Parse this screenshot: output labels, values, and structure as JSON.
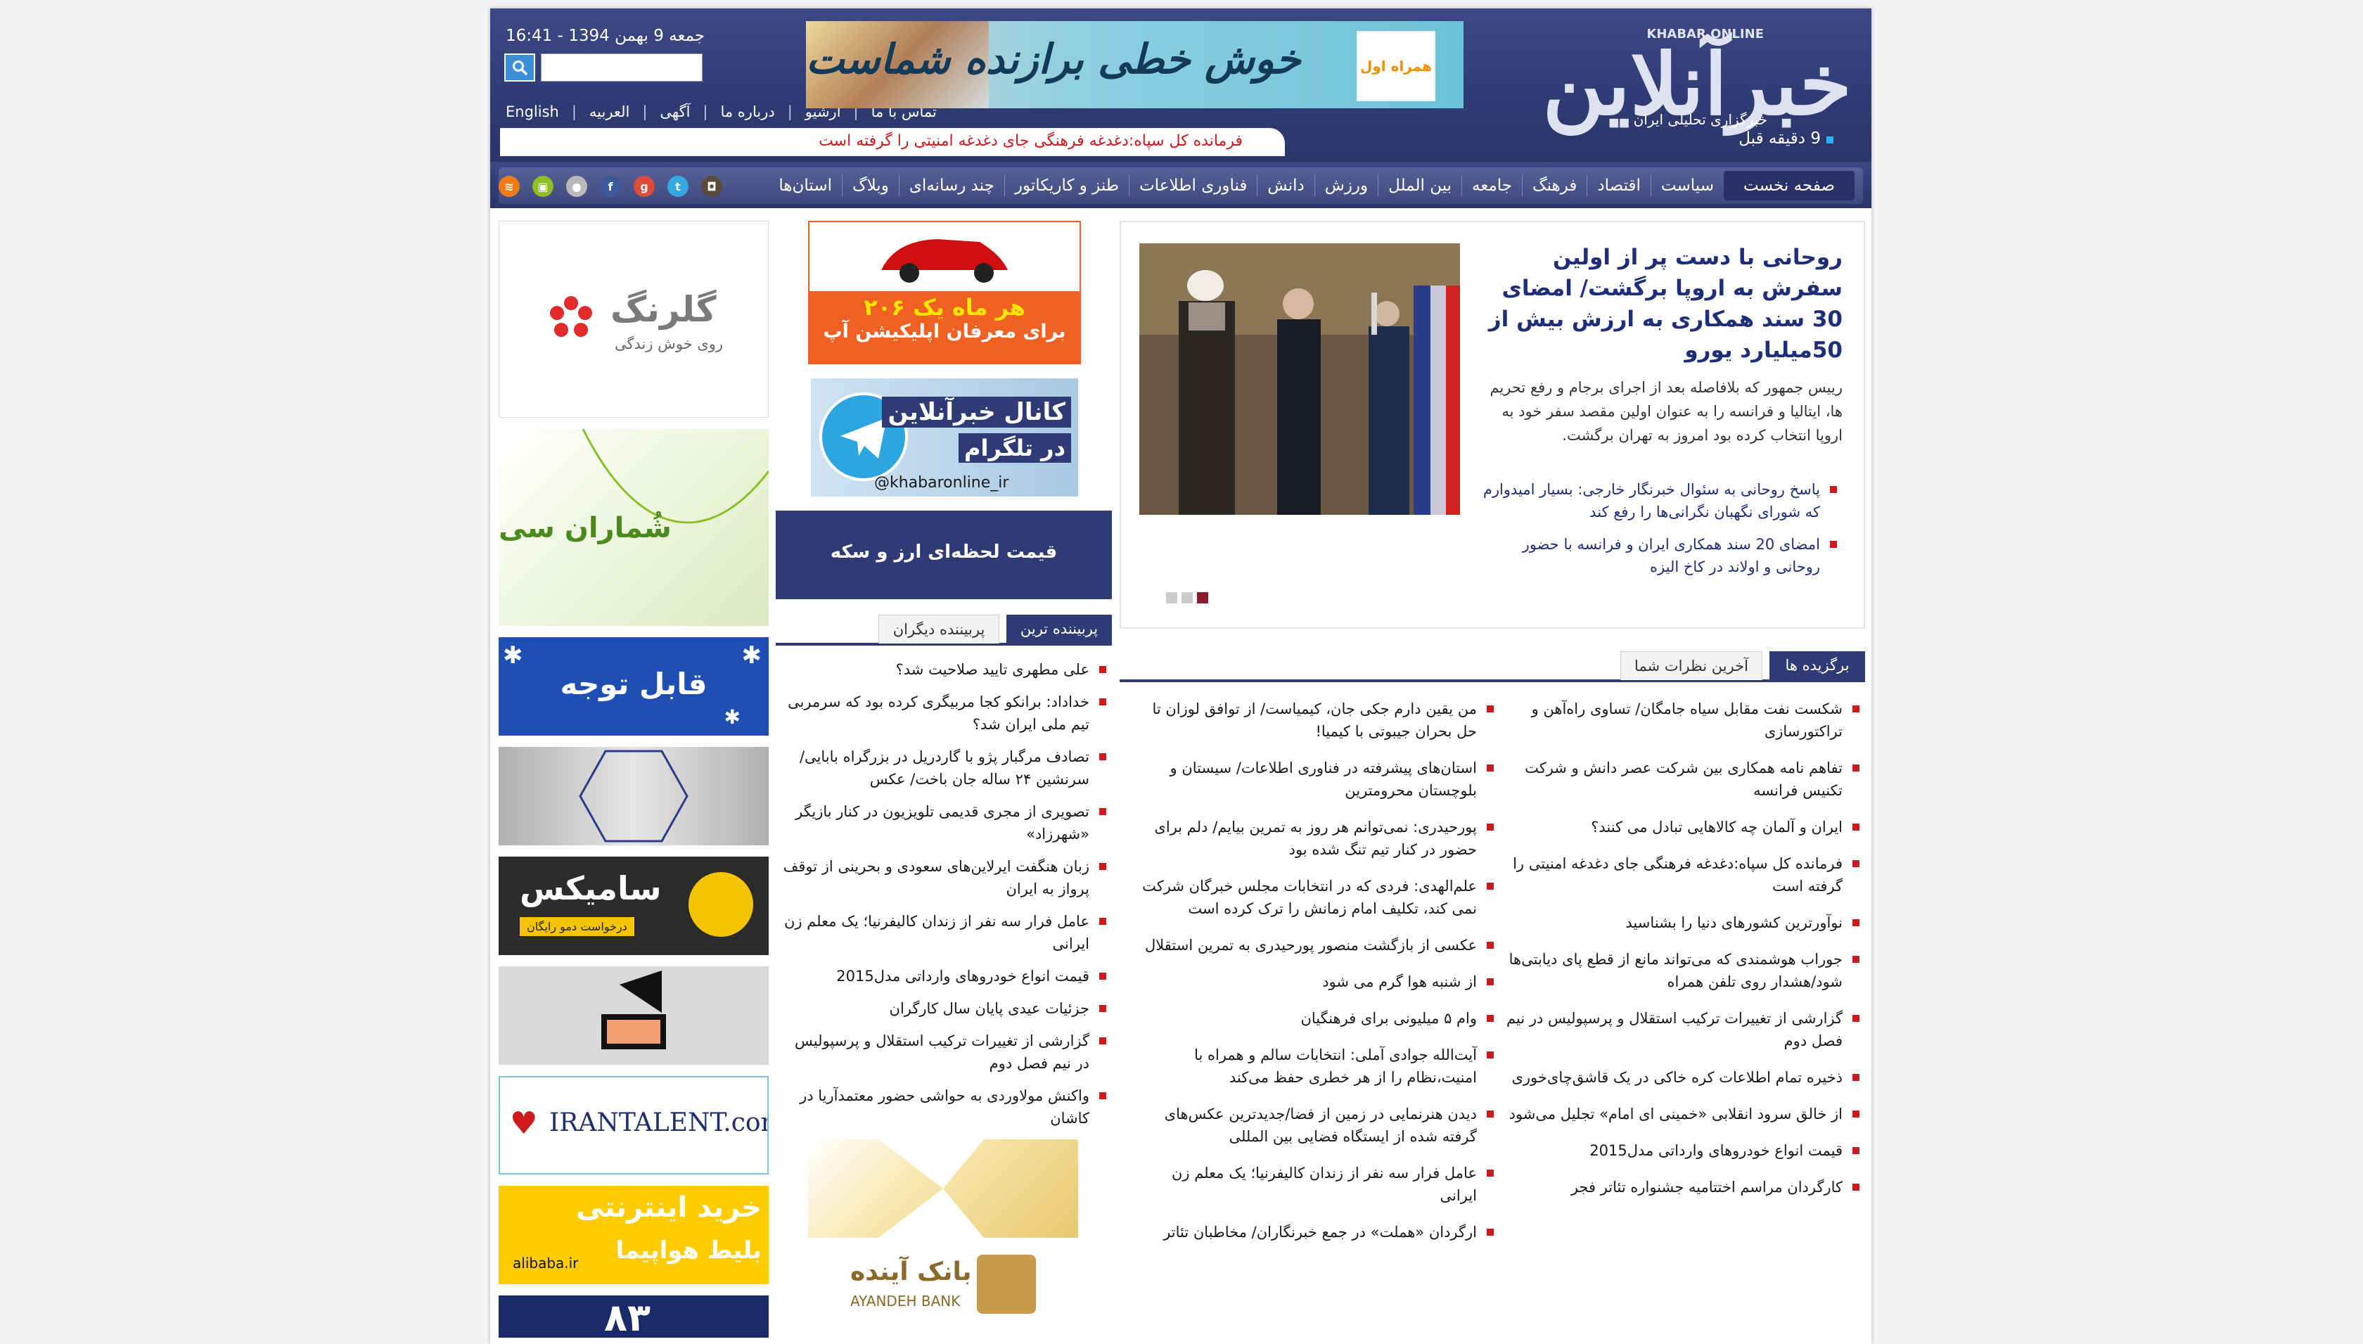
{
  "header": {
    "datetime": "جمعه 9 بهمن 1394 - 16:41",
    "logo_brand": "خبرآنلاین",
    "logo_en": "KHABAR ONLINE",
    "tagline": "خبرگزاری تحلیلی ایران",
    "banner_text": "خوش خطی برازنده شماست ...",
    "banner_logo": "همراه اول",
    "toplinks": [
      "تماس با ما",
      "آرشیو",
      "درباره ما",
      "آگهی",
      "العربیه",
      "English"
    ],
    "ticker_time": "9 دقیقه قبل",
    "ticker_text": "فرمانده کل سپاه:دغدغه فرهنگی جای دغدغه امنیتی را گرفته است"
  },
  "nav": {
    "items": [
      "صفحه نخست",
      "سیاست",
      "اقتصاد",
      "فرهنگ",
      "جامعه",
      "بین الملل",
      "ورزش",
      "دانش",
      "فناوری اطلاعات",
      "طنز و کاریکاتور",
      "چند رسانه‌ای",
      "وبلاگ",
      "استان‌ها"
    ],
    "socials": [
      {
        "name": "rss-icon",
        "color": "#f07a18",
        "glyph": "≋"
      },
      {
        "name": "android-icon",
        "color": "#8cbf26",
        "glyph": "▣"
      },
      {
        "name": "apple-icon",
        "color": "#b9b9b9",
        "glyph": "●"
      },
      {
        "name": "facebook-icon",
        "color": "#3b5998",
        "glyph": "f"
      },
      {
        "name": "googleplus-icon",
        "color": "#dd4b39",
        "glyph": "g"
      },
      {
        "name": "twitter-icon",
        "color": "#35a8e0",
        "glyph": "t"
      },
      {
        "name": "instagram-icon",
        "color": "#5b4b3a",
        "glyph": "◘"
      }
    ]
  },
  "ads": {
    "golrang": {
      "title": "گلرنگ",
      "sub": "روی خوش زندگی"
    },
    "shomaran": "شُماران سی",
    "attention": "قابل توجه",
    "samix": {
      "title": "سامیکس",
      "sub": "درخواست دمو رایگان"
    },
    "irantalent": "IRANTALENT.com",
    "alibaba": {
      "title": "خرید اینترنتی",
      "sub": "بلیط هواپیما",
      "brand": "alibaba.ir"
    },
    "bottom": "۸۳",
    "car": {
      "line1": "هر ماه یک ۲۰۶",
      "line2": "برای معرفان اپلیکیشن آپ"
    },
    "telegram": {
      "line1": "کانال خبرآنلاین",
      "line2": "در تلگرام",
      "handle": "@khabaronline_ir"
    },
    "rates": "قیمت لحظه‌ای ارز و سکه",
    "bank": {
      "fa": "بانک آینده",
      "en": "AYANDEH BANK"
    }
  },
  "midtabs": {
    "on": "پربیننده ترین",
    "off": "پربیننده دیگران"
  },
  "mostviewed": [
    "علی مطهری تایید صلاحیت شد؟",
    "خداداد: برانکو کجا مربیگری کرده بود که سرمربی تیم ملی ایران شد؟",
    "تصادف مرگبار پژو با گاردریل در بزرگراه بابایی/ سرنشین ۲۴ ساله جان باخت/ عکس",
    "تصویری از مجری قدیمی تلویزیون در کنار بازیگر «شهرزاد»",
    "زبان هنگفت ایرلاین‌های سعودی و بحرینی از توقف پرواز به ایران",
    "عامل فرار سه نفر از زندان کالیفرنیا؛ یک معلم زن ایرانی",
    "قیمت انواع خودروهای وارداتی مدل2015",
    "جزئیات عیدی پایان سال کارگران",
    "گزارشی از تغییرات ترکیب استقلال و پرسپولیس در نیم فصل دوم",
    "واکنش مولاوردی به حواشی حضور معتمدآریا در کاشان"
  ],
  "lead": {
    "title": "روحانی با دست پر از اولین سفرش به اروپا برگشت/ امضای 30 سند همکاری به ارزش بیش از 50میلیارد یورو",
    "desc": "رییس جمهور که بلافاصله بعد از اجرای برجام و رفع تحریم ها، ایتالیا و فرانسه را به عنوان اولین مقصد سفر خود به اروپا انتخاب کرده بود امروز به تهران برگشت.",
    "related": [
      "پاسخ روحانی به سئوال خبرنگار خارجی: بسیار امیدوارم که شورای نگهبان نگرانی‌ها را رفع کند",
      "امضای 20 سند همکاری ایران و فرانسه با حضور روحانی و اولاند در کاخ الیزه"
    ]
  },
  "righttabs": {
    "on": "برگزیده ها",
    "off": "آخرین نظرات شما"
  },
  "selected_right": [
    "شکست نفت مقابل سیاه جامگان/ تساوی راه‌آهن و تراکتورسازی",
    "تفاهم نامه همکاری بین شرکت عصر دانش و شرکت تکنیس فرانسه",
    "ایران و آلمان چه کالاهایی تبادل می کنند؟",
    "فرمانده کل سپاه:دغدغه فرهنگی جای دغدغه امنیتی را گرفته است",
    "نوآورترین کشورهای دنیا را بشناسید",
    "جوراب هوشمندی که می‌تواند مانع از قطع پای دیابتی‌ها شود/هشدار روی تلفن همراه",
    "گزارشی از تغییرات ترکیب استقلال و پرسپولیس در نیم فصل دوم",
    "ذخیره تمام اطلاعات کره خاکی در یک قاشق‌چای‌خوری",
    "از خالق سرود انقلابی «خمینی ای امام» تجلیل می‌شود",
    "قیمت انواع خودروهای وارداتی مدل2015",
    "کارگردان مراسم اختتامیه جشنواره تئاتر فجر"
  ],
  "selected_left": [
    "من یقین دارم جکی جان، کیمیاست/ از توافق لوزان تا حل بحران جیبوتی با کیمیا!",
    "استان‌های پیشرفته در فناوری اطلاعات/ سیستان و بلوچستان محرومترین",
    "پورحیدری: نمی‌توانم هر روز به تمرین بیایم/ دلم برای حضور در کنار تیم تنگ شده بود",
    "علم‌الهدی: فردی که در انتخابات مجلس خبرگان شرکت نمی کند، تکلیف امام زمانش را ترک کرده است",
    "عکسی از بازگشت منصور پورحیدری به تمرین استقلال",
    "از شنبه هوا گرم می شود",
    "وام ۵ میلیونی برای فرهنگیان",
    "آیت‌الله جوادی آملی: انتخابات سالم و همراه با امنیت،نظام را از هر خطری حفظ می‌کند",
    "دیدن هنرنمایی در زمین از فضا/جدیدترین عکس‌های گرفته شده از ایستگاه فضایی بین المللی",
    "عامل فرار سه نفر از زندان کالیفرنیا؛ یک معلم زن ایرانی",
    "ارگردان «هملت» در جمع خبرنگاران/ مخاطبان تئاتر"
  ]
}
